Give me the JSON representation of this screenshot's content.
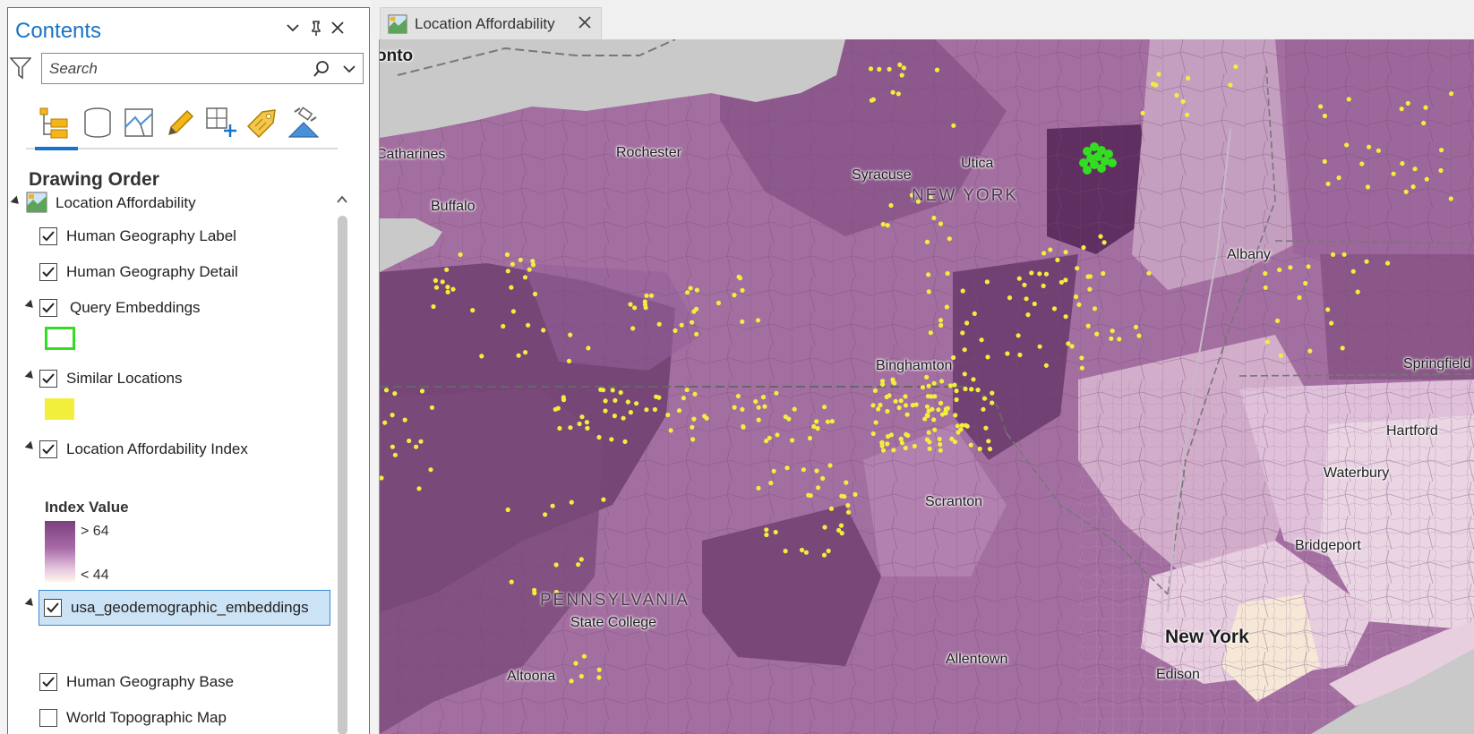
{
  "pane": {
    "title": "Contents",
    "search_placeholder": "Search",
    "section_title": "Drawing Order",
    "view_tabs": [
      "list-by-drawing-order",
      "list-by-data-source",
      "list-by-editing",
      "list-by-selection",
      "list-by-snapping",
      "list-by-labeling",
      "list-by-perspective-imagery"
    ]
  },
  "layers": {
    "map": "Location Affordability",
    "label_layer": "Human Geography Label",
    "detail_layer": "Human Geography Detail",
    "query_layer": "Query Embeddings",
    "similar_layer": "Similar Locations",
    "lai_layer": "Location Affordability Index",
    "legend_title": "Index Value",
    "legend_high": "> 64",
    "legend_low": "< 44",
    "embeddings_layer": "usa_geodemographic_embeddings",
    "base_layer": "Human Geography Base",
    "topo_layer": "World Topographic Map"
  },
  "checked": {
    "label_layer": true,
    "detail_layer": true,
    "query_layer": true,
    "similar_layer": true,
    "lai_layer": true,
    "embeddings_layer": true,
    "base_layer": true,
    "topo_layer": false
  },
  "colors": {
    "query_symbol": "#33dd22",
    "similar_symbol": "#f2ee3c",
    "accent": "#1a73c8",
    "selection": "#cce3f5"
  },
  "map_tab": {
    "label": "Location Affordability"
  },
  "map_labels": {
    "toronto": "onto",
    "catharines": "Catharines",
    "rochester": "Rochester",
    "syracuse": "Syracuse",
    "utica": "Utica",
    "new_york_state": "NEW YORK",
    "buffalo": "Buffalo",
    "albany": "Albany",
    "binghamton": "Binghamton",
    "springfield": "Springfield",
    "hartford": "Hartford",
    "waterbury": "Waterbury",
    "scranton": "Scranton",
    "bridgeport": "Bridgeport",
    "pennsylvania": "PENNSYLVANIA",
    "state_college": "State College",
    "new_york_city": "New York",
    "allentown": "Allentown",
    "edison": "Edison",
    "altoona": "Altoona"
  }
}
